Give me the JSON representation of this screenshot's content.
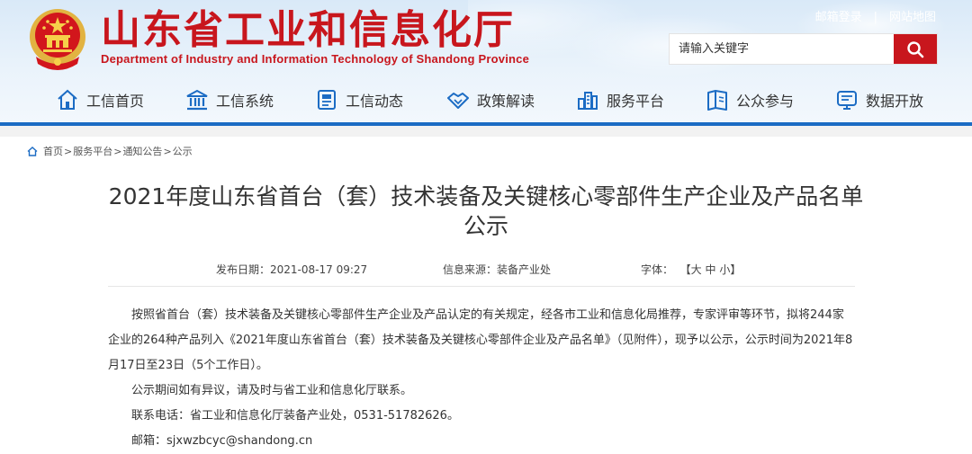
{
  "header": {
    "title_cn": "山东省工业和信息化厅",
    "title_en": "Department of Industry and Information Technology of Shandong Province",
    "top_links": [
      "邮箱登录",
      "网站地图"
    ],
    "top_links_sep": "|",
    "search": {
      "placeholder": "请输入关键字",
      "button_icon": "search-icon"
    },
    "brand_color": "#c8161d",
    "accent_color": "#1c6cc4"
  },
  "nav": [
    {
      "label": "工信首页",
      "icon": "home-icon"
    },
    {
      "label": "工信系统",
      "icon": "institution-icon"
    },
    {
      "label": "工信动态",
      "icon": "news-icon"
    },
    {
      "label": "政策解读",
      "icon": "handshake-icon"
    },
    {
      "label": "服务平台",
      "icon": "city-icon"
    },
    {
      "label": "公众参与",
      "icon": "book-icon"
    },
    {
      "label": "数据开放",
      "icon": "data-screen-icon"
    }
  ],
  "breadcrumb": [
    "首页",
    "服务平台",
    "通知公告",
    "公示"
  ],
  "breadcrumb_sep": ">",
  "article": {
    "title": "2021年度山东省首台（套）技术装备及关键核心零部件生产企业及产品名单公示",
    "publish_label": "发布日期：",
    "publish_date": "2021-08-17 09:27",
    "source_label": "信息来源：",
    "source": "装备产业处",
    "font_label": "字体：",
    "font_open": "【",
    "font_sizes": [
      "大",
      "中",
      "小"
    ],
    "font_close": "】",
    "paragraphs": [
      "按照省首台（套）技术装备及关键核心零部件生产企业及产品认定的有关规定，经各市工业和信息化局推荐，专家评审等环节，拟将244家企业的264种产品列入《2021年度山东省首台（套）技术装备及关键核心零部件企业及产品名单》（见附件），现予以公示，公示时间为2021年8月17日至23日（5个工作日）。",
      "公示期间如有异议，请及时与省工业和信息化厅联系。",
      "联系电话：省工业和信息化厅装备产业处，0531-51782626。",
      "邮箱：sjxwzbcyc@shandong.cn"
    ]
  }
}
